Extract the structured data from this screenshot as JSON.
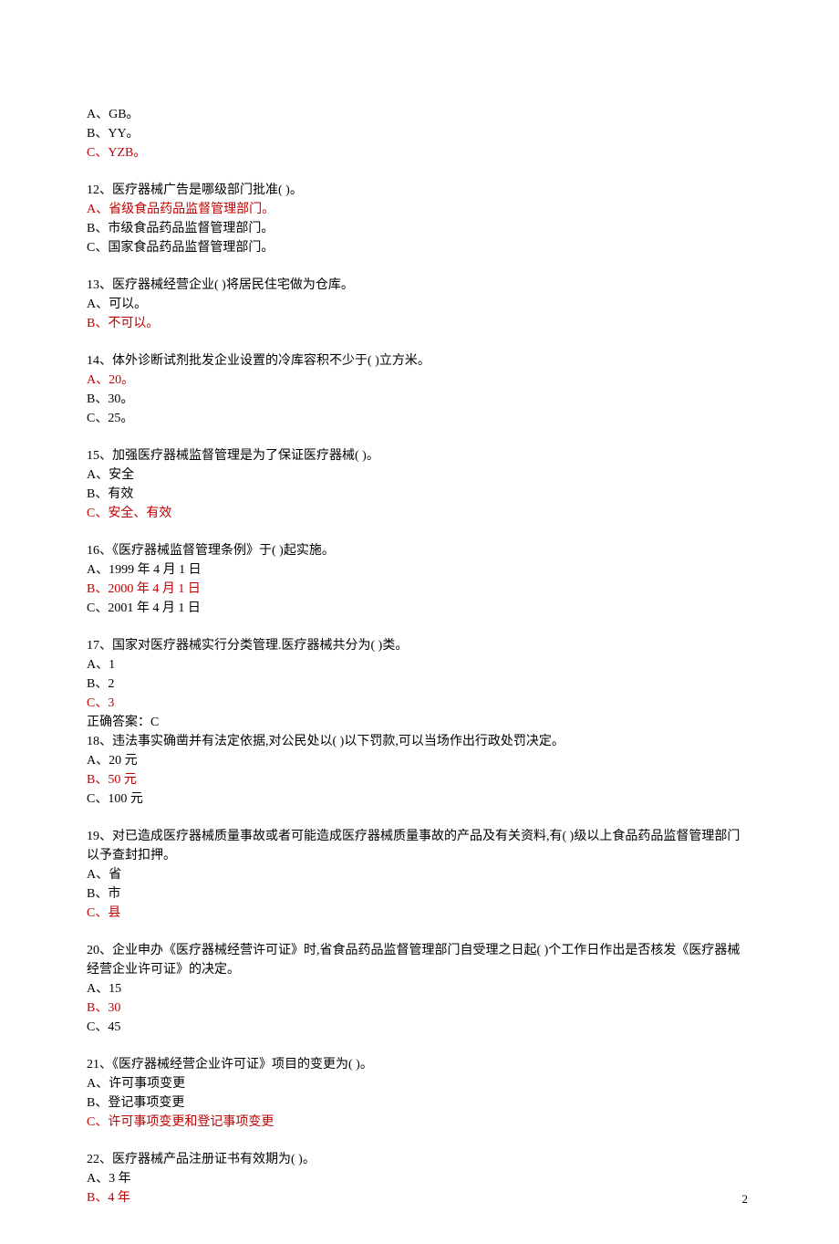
{
  "partial_q11": {
    "opt_a": "A、GB。",
    "opt_b": "B、YY。",
    "opt_c": "C、YZB。"
  },
  "q12": {
    "stem": "12、医疗器械广告是哪级部门批准(   )。",
    "opt_a": "A、省级食品药品监督管理部门。",
    "opt_b": "B、市级食品药品监督管理部门。",
    "opt_c": "C、国家食品药品监督管理部门。"
  },
  "q13": {
    "stem": "13、医疗器械经营企业(   )将居民住宅做为仓库。",
    "opt_a": "A、可以。",
    "opt_b": "B、不可以。"
  },
  "q14": {
    "stem": "14、体外诊断试剂批发企业设置的冷库容积不少于(   )立方米。",
    "opt_a": "A、20。",
    "opt_b": "B、30。",
    "opt_c": "C、25。"
  },
  "q15": {
    "stem": "15、加强医疗器械监督管理是为了保证医疗器械(   )。",
    "opt_a": "A、安全",
    "opt_b": "B、有效",
    "opt_c": "C、安全、有效"
  },
  "q16": {
    "stem": "16、《医疗器械监督管理条例》于(   )起实施。",
    "opt_a": "A、1999 年 4 月 1 日",
    "opt_b": "B、2000 年 4 月 1 日",
    "opt_c": "C、2001 年 4 月 1 日"
  },
  "q17": {
    "stem": "17、国家对医疗器械实行分类管理.医疗器械共分为(   )类。",
    "opt_a": "A、1",
    "opt_b": "B、2",
    "opt_c": "C、3",
    "note": "正确答案：C"
  },
  "q18": {
    "stem": "18、违法事实确凿并有法定依据,对公民处以(   )以下罚款,可以当场作出行政处罚决定。",
    "opt_a": "A、20 元",
    "opt_b": "B、50 元",
    "opt_c": "C、100 元"
  },
  "q19": {
    "stem": "19、对已造成医疗器械质量事故或者可能造成医疗器械质量事故的产品及有关资料,有(   )级以上食品药品监督管理部门以予查封扣押。",
    "opt_a": "A、省",
    "opt_b": "B、市",
    "opt_c": "C、县"
  },
  "q20": {
    "stem": "20、企业申办《医疗器械经营许可证》时,省食品药品监督管理部门自受理之日起(   )个工作日作出是否核发《医疗器械经营企业许可证》的决定。",
    "opt_a": "A、15",
    "opt_b": "B、30",
    "opt_c": "C、45"
  },
  "q21": {
    "stem": "21、《医疗器械经营企业许可证》项目的变更为(   )。",
    "opt_a": "A、许可事项变更",
    "opt_b": "B、登记事项变更",
    "opt_c": "C、许可事项变更和登记事项变更"
  },
  "q22": {
    "stem": "22、医疗器械产品注册证书有效期为(   )。",
    "opt_a": "A、3 年",
    "opt_b": "B、4 年"
  },
  "page_number": "2"
}
